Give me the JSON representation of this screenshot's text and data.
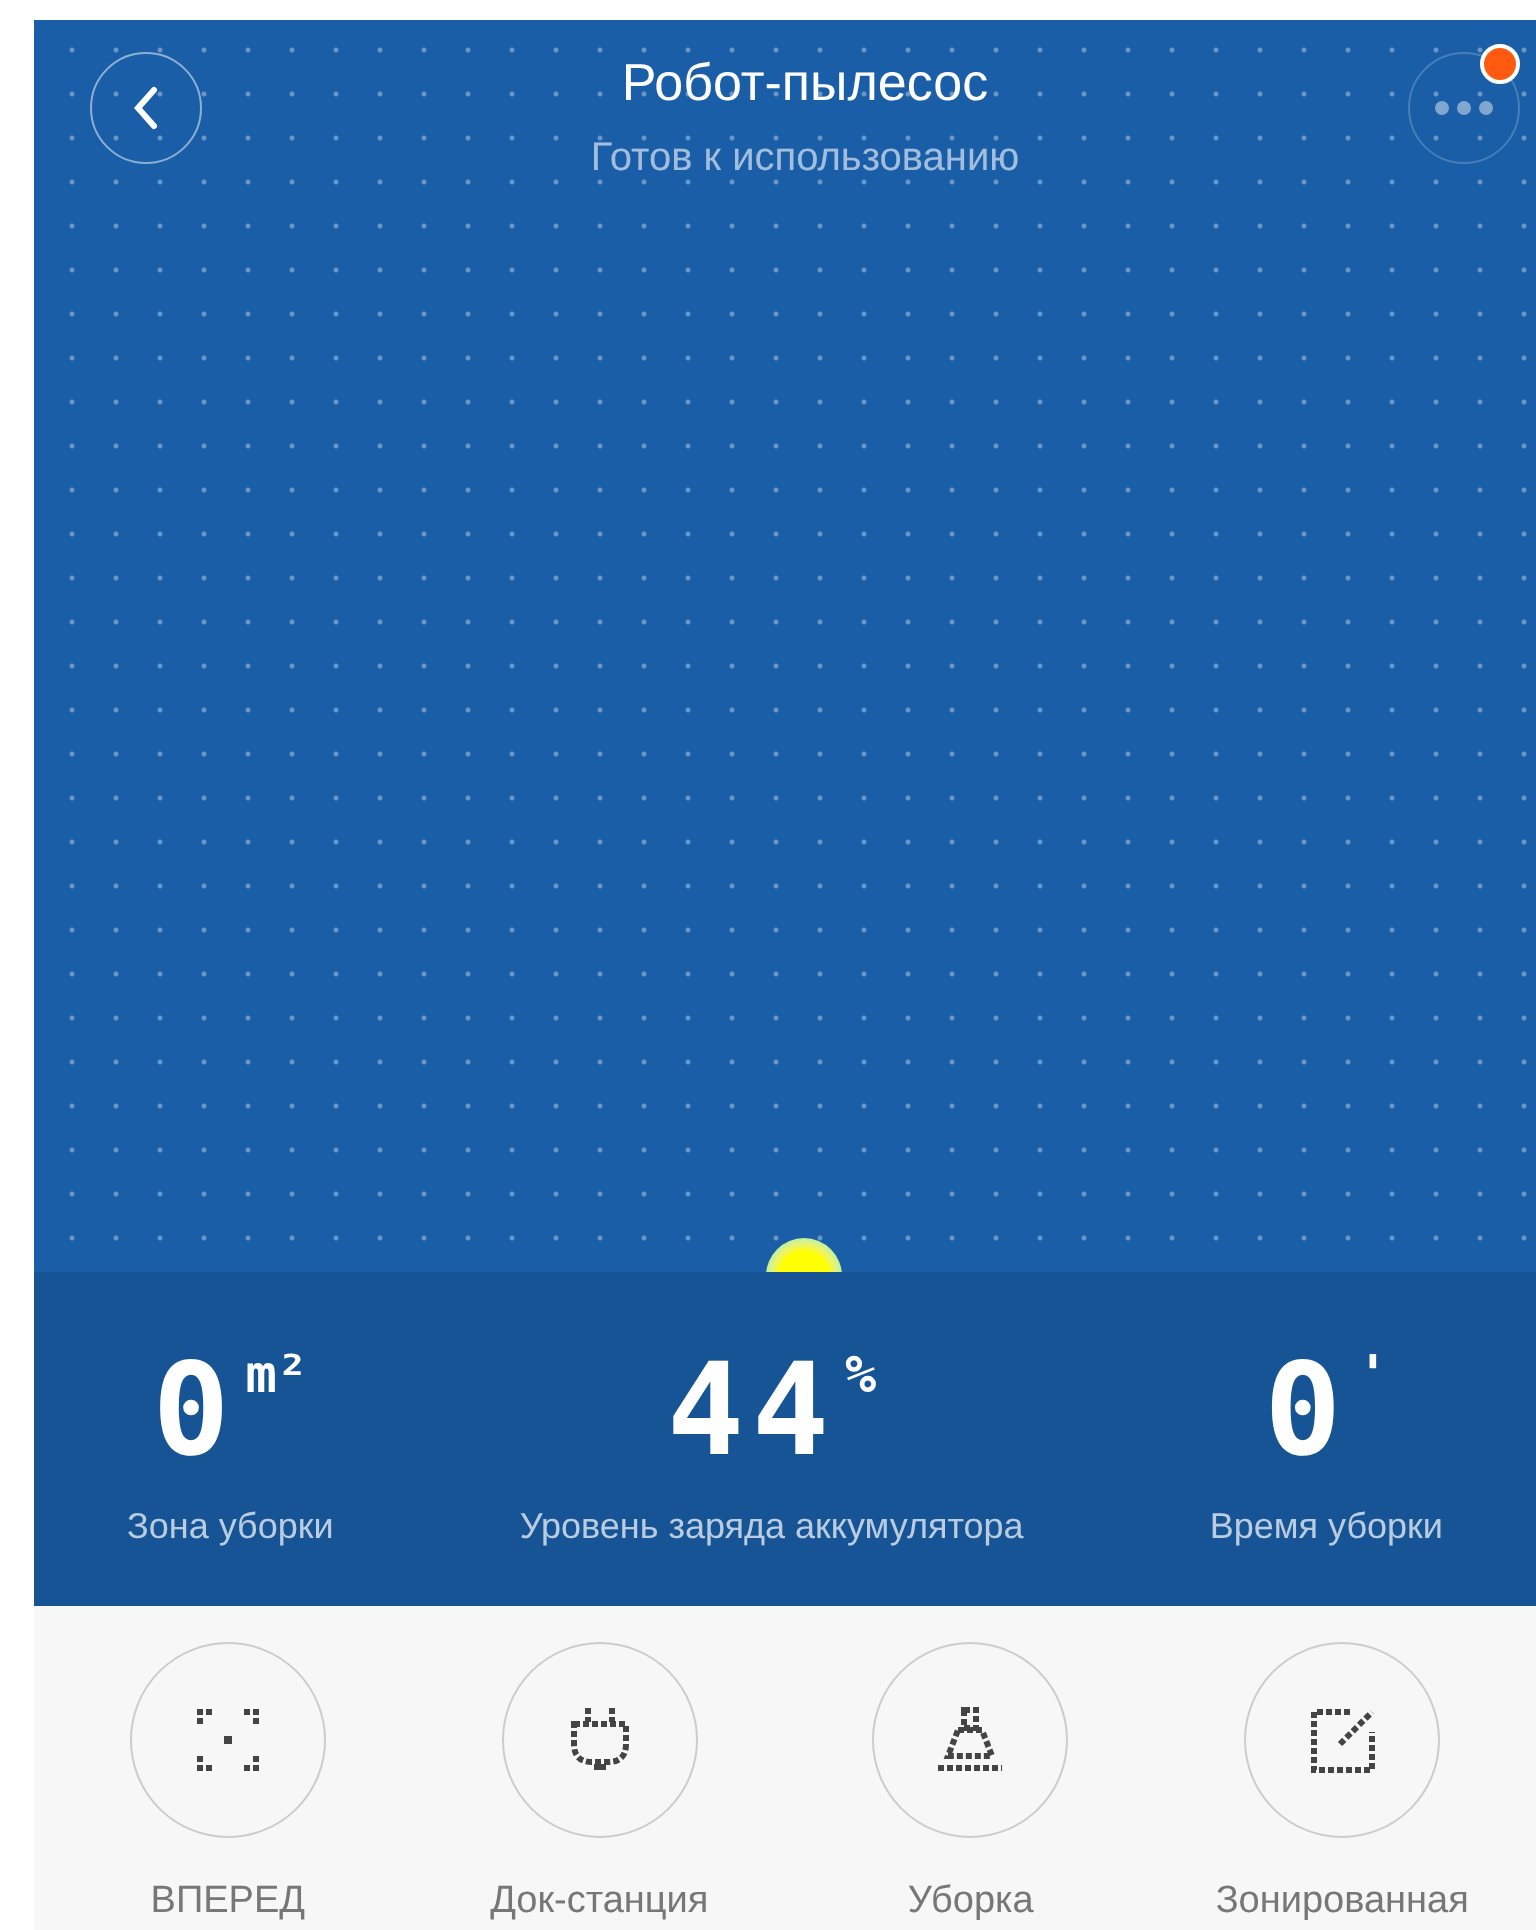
{
  "header": {
    "title": "Робот-пылесос",
    "status": "Готов к использованию",
    "notification": true
  },
  "stats": [
    {
      "value": "0",
      "unit": "m²",
      "label": "Зона уборки"
    },
    {
      "value": "44",
      "unit": "%",
      "label": "Уровень заряда аккумулятора"
    },
    {
      "value": "0",
      "unit": "'",
      "label": "Время уборки"
    }
  ],
  "actions": [
    {
      "kind": "forward",
      "label": "ВПЕРЕД"
    },
    {
      "kind": "dock",
      "label": "Док-станция"
    },
    {
      "kind": "clean",
      "label": "Уборка"
    },
    {
      "kind": "zone",
      "label": "Зонированная"
    }
  ]
}
